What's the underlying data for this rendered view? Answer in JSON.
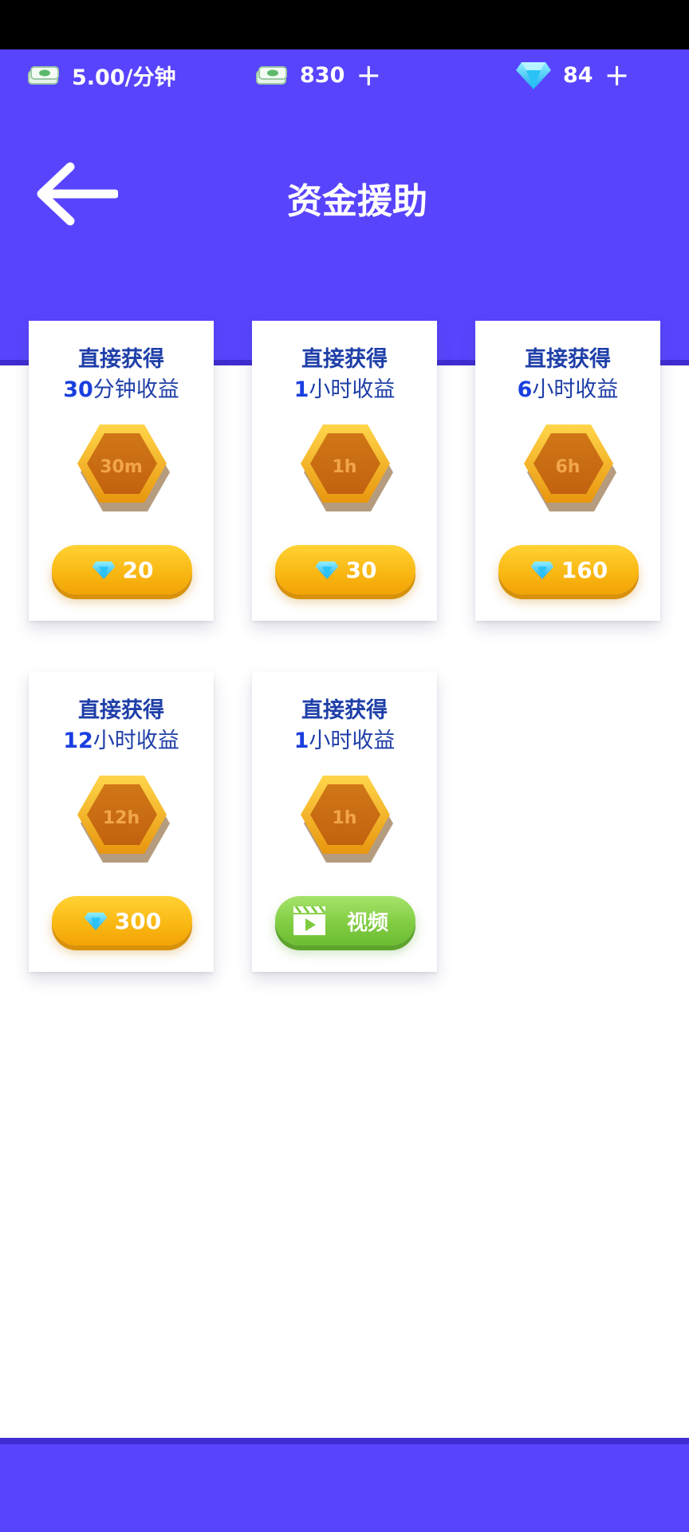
{
  "colors": {
    "header": "#5844fd",
    "accent_dark": "#3f2dd1",
    "text_blue": "#1f3fa8",
    "gold": "#f9b611",
    "green": "#7ecb3f"
  },
  "topbar": {
    "rate": {
      "icon": "cash-icon",
      "value": "5.00/分钟"
    },
    "cash": {
      "icon": "cash-icon",
      "value": "830",
      "plus": "+"
    },
    "gems": {
      "icon": "diamond-icon",
      "value": "84",
      "plus": "+"
    }
  },
  "header": {
    "back_icon": "arrow-left-icon",
    "title": "资金援助"
  },
  "cards": [
    {
      "line1": "直接获得",
      "amount": "30",
      "unit": "分钟收益",
      "coin_label": "30m",
      "price": "20",
      "action": "diamond"
    },
    {
      "line1": "直接获得",
      "amount": "1",
      "unit": "小时收益",
      "coin_label": "1h",
      "price": "30",
      "action": "diamond"
    },
    {
      "line1": "直接获得",
      "amount": "6",
      "unit": "小时收益",
      "coin_label": "6h",
      "price": "160",
      "action": "diamond"
    },
    {
      "line1": "直接获得",
      "amount": "12",
      "unit": "小时收益",
      "coin_label": "12h",
      "price": "300",
      "action": "diamond"
    },
    {
      "line1": "直接获得",
      "amount": "1",
      "unit": "小时收益",
      "coin_label": "1h",
      "video_label": "视频",
      "action": "video"
    }
  ]
}
